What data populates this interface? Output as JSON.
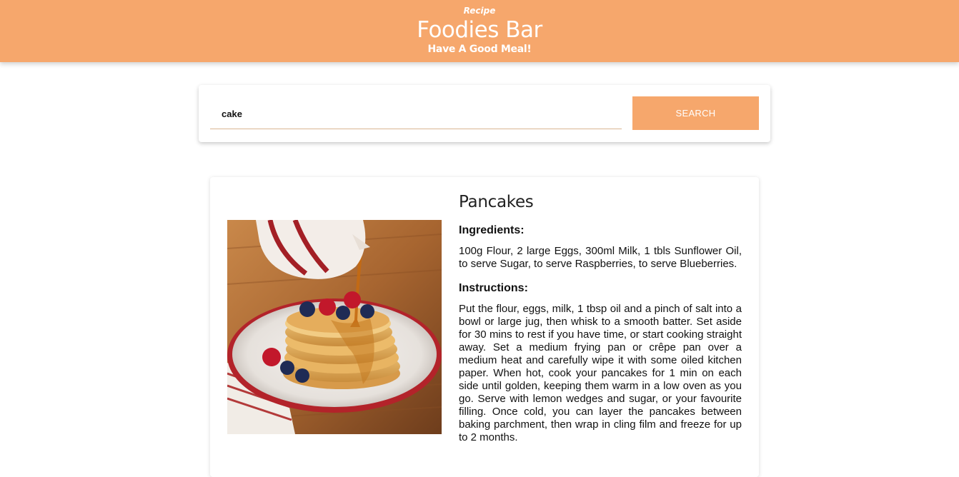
{
  "header": {
    "tag": "Recipe",
    "title": "Foodies Bar",
    "subtitle": "Have A Good Meal!"
  },
  "search": {
    "value": "cake",
    "button_label": "SEARCH"
  },
  "recipe": {
    "title": "Pancakes",
    "ingredients_heading": "Ingredients:",
    "ingredients": "100g Flour, 2 large Eggs, 300ml Milk, 1 tbls Sunflower Oil, to serve Sugar, to serve Raspberries, to serve Blueberries.",
    "instructions_heading": "Instructions:",
    "instructions": "Put the flour, eggs, milk, 1 tbsp oil and a pinch of salt into a bowl or large jug, then whisk to a smooth batter. Set aside for 30 mins to rest if you have time, or start cooking straight away. Set a medium frying pan or crêpe pan over a medium heat and carefully wipe it with some oiled kitchen paper. When hot, cook your pancakes for 1 min on each side until golden, keeping them warm in a low oven as you go. Serve with lemon wedges and sugar, or your favourite filling. Once cold, you can layer the pancakes between baking parchment, then wrap in cling film and freeze for up to 2 months."
  },
  "colors": {
    "accent": "#f6a76c",
    "input_underline": "#d9b592"
  }
}
